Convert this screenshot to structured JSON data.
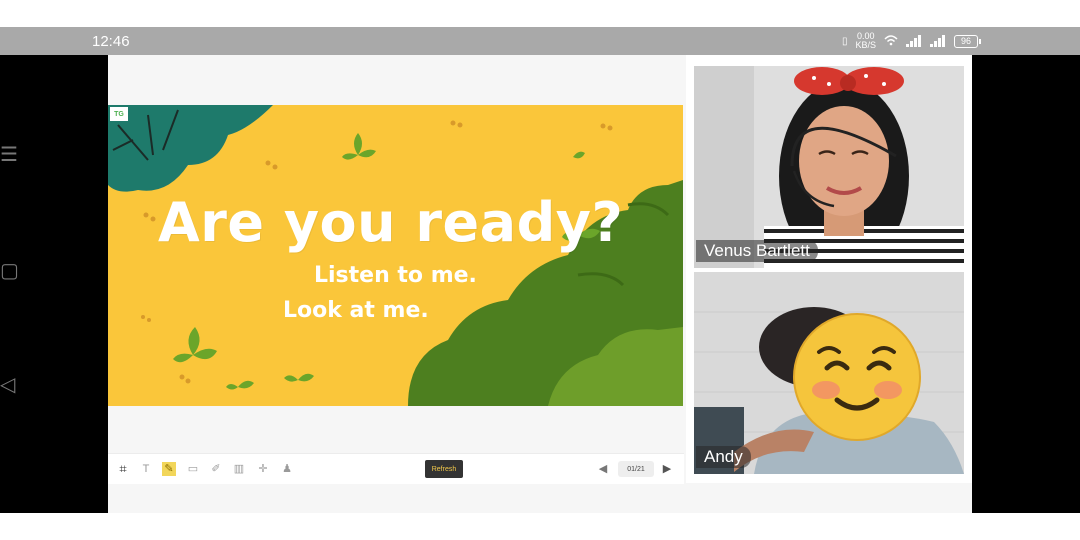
{
  "status_bar": {
    "time": "12:46",
    "speed_value": "0.00",
    "speed_unit": "KB/S",
    "battery": "96"
  },
  "slide": {
    "badge": "TG",
    "title": "Are you ready?",
    "line1": "Listen to me.",
    "line2": "Look at me."
  },
  "toolbar": {
    "refresh_label": "Refresh",
    "page_indicator": "01/21"
  },
  "participants": [
    {
      "name": "Venus Bartlett"
    },
    {
      "name": "Andy"
    }
  ],
  "colors": {
    "slide_bg": "#fac63a",
    "leaf_dark_green": "#3f6f1f",
    "leaf_teal": "#1e7a6b",
    "refresh_text": "#f2c94c"
  }
}
